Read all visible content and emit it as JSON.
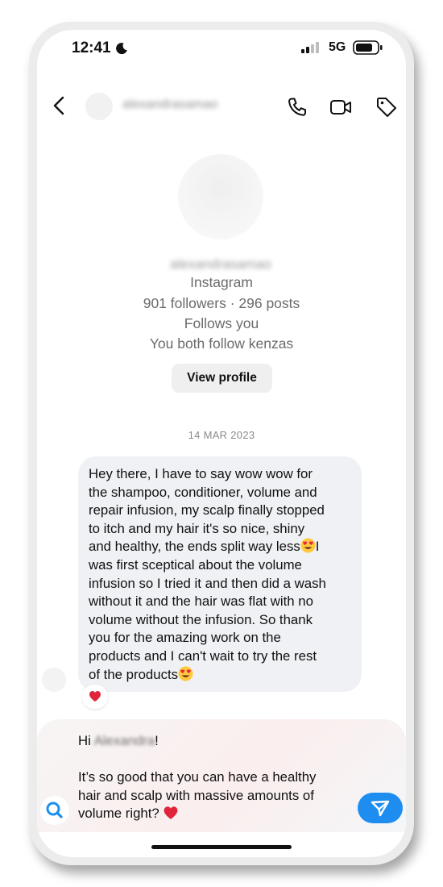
{
  "status_bar": {
    "time": "12:41",
    "network": "5G",
    "icons": [
      "moon-icon",
      "signal-icon",
      "battery-icon"
    ]
  },
  "header": {
    "username": "alexandrasamao",
    "icons": [
      "back-chevron-icon",
      "phone-icon",
      "video-icon",
      "tag-icon"
    ]
  },
  "profile": {
    "name": "alexandrasamao",
    "platform": "Instagram",
    "stats": "901 followers · 296 posts",
    "follows_you": "Follows you",
    "mutual": "You both follow kenzas",
    "view_profile_label": "View profile"
  },
  "thread": {
    "date": "14 MAR 2023",
    "message_lines": [
      "Hey there, I have to say wow wow for",
      "the shampoo, conditioner, volume and",
      "repair infusion, my scalp finally stopped",
      "to itch and my hair it's so nice, shiny",
      "and healthy, the ends split way less",
      "was first sceptical about the volume",
      "infusion so I tried it and then did a wash",
      "without it and the hair was flat with no",
      "volume without the infusion. So thank",
      "you for the amazing work on the",
      "products and I can't wait to try the rest",
      "of the products"
    ],
    "message_line5_suffix": "I",
    "reaction": "heart-icon"
  },
  "composer": {
    "greeting_prefix": "Hi ",
    "greeting_name": "Alexandra",
    "greeting_suffix": "!",
    "body_lines": [
      "It’s so good that you can have a healthy",
      "hair and scalp with massive amounts of",
      "volume right?"
    ]
  },
  "colors": {
    "accent": "#1d8ef0",
    "bubble": "#eff1f4",
    "muted_text": "#6b6b6b",
    "heart": "#e0243a"
  }
}
